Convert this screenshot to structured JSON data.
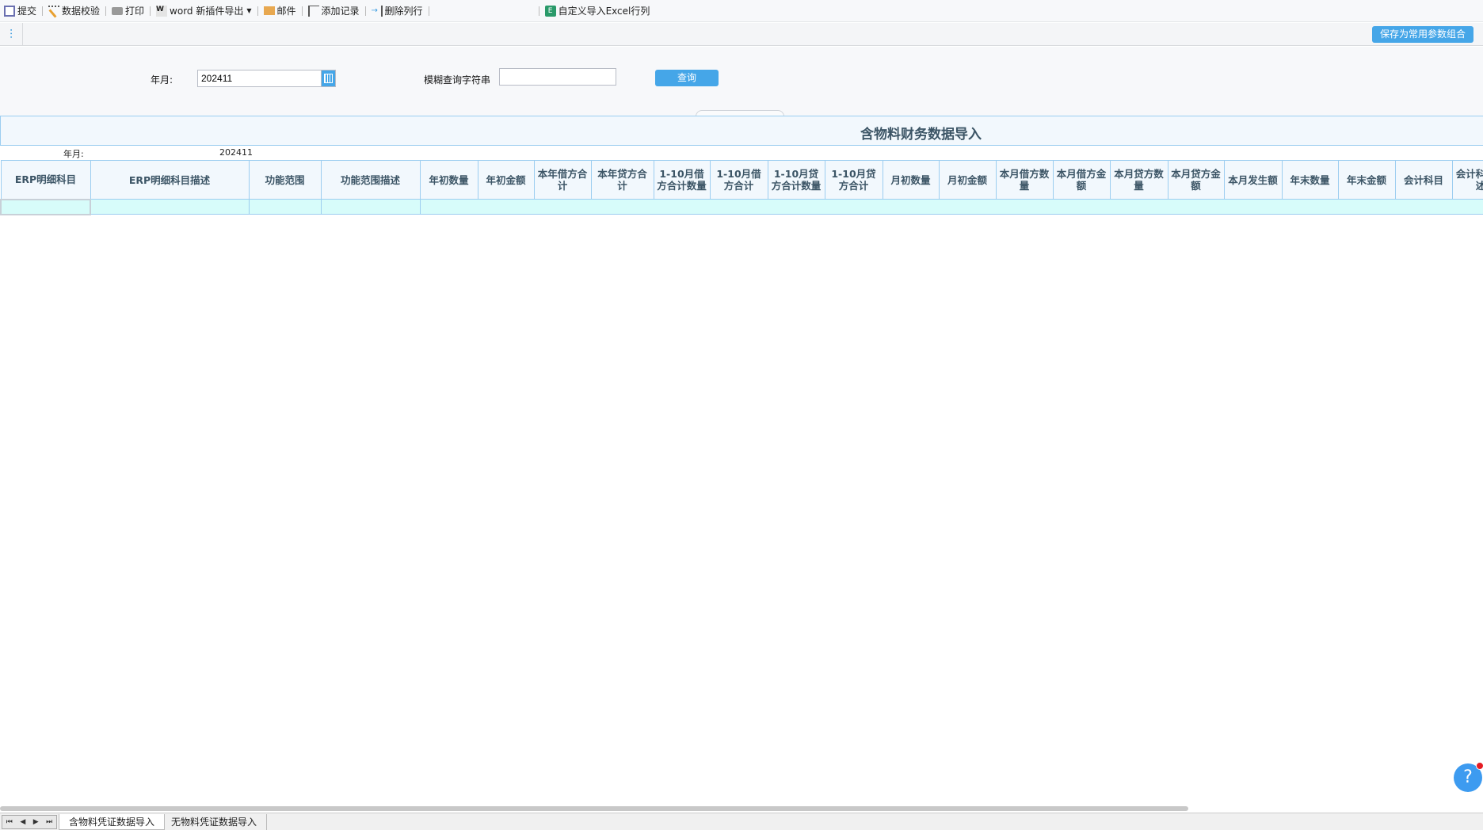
{
  "toolbar": {
    "items": [
      {
        "label": "提交",
        "icon": "save-icon"
      },
      {
        "label": "数据校验",
        "icon": "wand-icon"
      },
      {
        "label": "打印",
        "icon": "print-icon"
      },
      {
        "label": "word 新插件导出",
        "icon": "word-icon"
      },
      {
        "label": "邮件",
        "icon": "mail-icon"
      },
      {
        "label": "添加记录",
        "icon": "add-record-icon"
      },
      {
        "label": "删除列行",
        "icon": "delete-row-icon"
      },
      {
        "label": "自定义导入Excel行列",
        "icon": "excel-icon"
      }
    ]
  },
  "save_params_label": "保存为常用参数组合",
  "form": {
    "ym_label": "年月:",
    "ym_value": "202411",
    "fuzzy_label": "模糊查询字符串",
    "fuzzy_value": "",
    "query_label": "查询"
  },
  "report": {
    "title": "含物料财务数据导入",
    "ym_label": "年月:",
    "ym_value": "202411"
  },
  "columns": [
    "ERP明细科目",
    "ERP明细科目描述",
    "功能范围",
    "功能范围描述",
    "年初数量",
    "年初金额",
    "本年借方合计",
    "本年贷方合计",
    "1-10月借方合计数量",
    "1-10月借方合计",
    "1-10月贷方合计数量",
    "1-10月贷方合计",
    "月初数量",
    "月初金额",
    "本月借方数量",
    "本月借方金额",
    "本月贷方数量",
    "本月贷方金额",
    "本月发生额",
    "年末数量",
    "年末金额",
    "会计科目",
    "会计科目描述"
  ],
  "sheet_tabs": [
    "含物料凭证数据导入",
    "无物料凭证数据导入"
  ],
  "colors": {
    "accent": "#45a6e8",
    "border": "#9ccdf0",
    "row": "#d7fcfa"
  }
}
